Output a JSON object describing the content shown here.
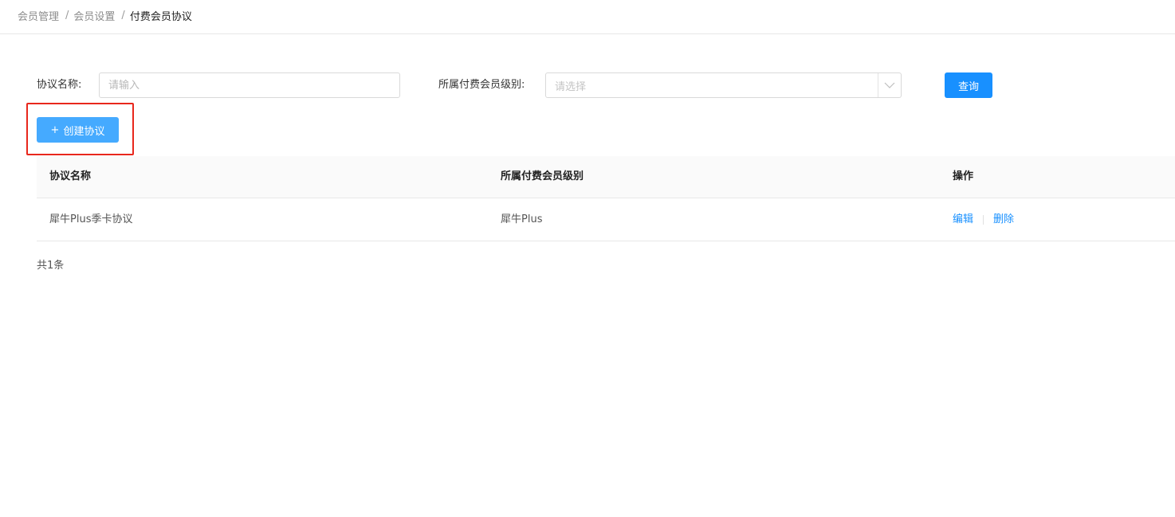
{
  "breadcrumb": {
    "items": [
      "会员管理",
      "会员设置",
      "付费会员协议"
    ],
    "separator": "/"
  },
  "filters": {
    "name_label": "协议名称:",
    "name_placeholder": "请输入",
    "level_label": "所属付费会员级别:",
    "level_placeholder": "请选择",
    "query_label": "查询"
  },
  "actions": {
    "create_plus": "+",
    "create_label": "创建协议"
  },
  "table": {
    "columns": [
      "协议名称",
      "所属付费会员级别",
      "操作"
    ],
    "rows": [
      {
        "name": "犀牛Plus季卡协议",
        "level": "犀牛Plus",
        "edit": "编辑",
        "delete": "删除"
      }
    ]
  },
  "pagination": {
    "total_text": "共1条"
  },
  "colors": {
    "primary": "#1890ff",
    "create_button": "#45aaff",
    "highlight_border": "#e8271c"
  },
  "icons": {
    "select_arrow": "chevron-down-icon"
  }
}
